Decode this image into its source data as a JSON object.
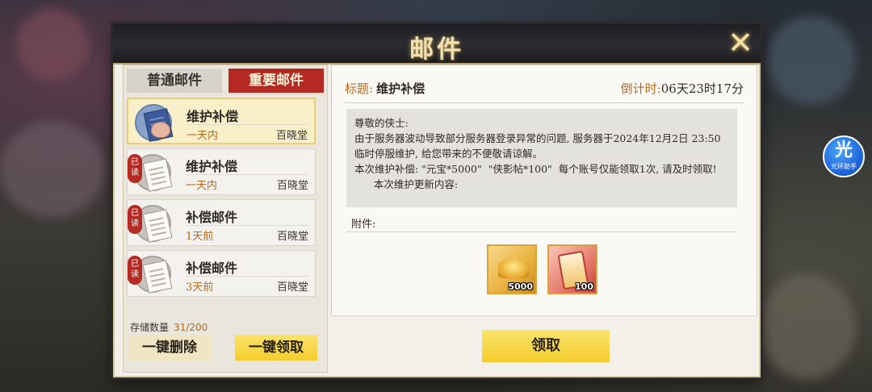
{
  "window": {
    "title": "邮件",
    "close_icon": "close-icon"
  },
  "tabs": {
    "normal_label": "普通邮件",
    "important_label": "重要邮件",
    "active": "important"
  },
  "mail_list": [
    {
      "title": "维护补偿",
      "time": "一天内",
      "sender": "百晓堂",
      "read": false,
      "selected": true
    },
    {
      "title": "维护补偿",
      "time": "一天内",
      "sender": "百晓堂",
      "read": true,
      "read_label": "已读",
      "selected": false
    },
    {
      "title": "补偿邮件",
      "time": "1天前",
      "sender": "百晓堂",
      "read": true,
      "read_label": "已读",
      "selected": false
    },
    {
      "title": "补偿邮件",
      "time": "3天前",
      "sender": "百晓堂",
      "read": true,
      "read_label": "已读",
      "selected": false
    }
  ],
  "storage": {
    "label": "存储数量",
    "count": "31/200"
  },
  "buttons": {
    "delete_all": "一键删除",
    "claim_all": "一键领取",
    "claim": "领取"
  },
  "detail": {
    "subject_label": "标题:",
    "subject": "维护补偿",
    "countdown_label": "倒计时:",
    "countdown": "06天23时17分",
    "body": [
      "尊敬的侠士:",
      "由于服务器波动导致部分服务器登录异常的问题, 服务器于2024年12月2日 23:50 临时停服维护, 给您带来的不便敬请谅解。",
      "本次维护补偿: \"元宝*5000\"  \"侠影帖*100\"  每个账号仅能领取1次, 请及时领取!",
      "      本次维护更新内容:"
    ],
    "attachments_label": "附件:",
    "attachments": [
      {
        "name": "元宝",
        "icon": "gold-ingot-icon",
        "qty": "5000"
      },
      {
        "name": "侠影帖",
        "icon": "ticket-icon",
        "qty": "100"
      }
    ]
  },
  "assistant": {
    "glyph": "光",
    "label": "光环助手"
  }
}
